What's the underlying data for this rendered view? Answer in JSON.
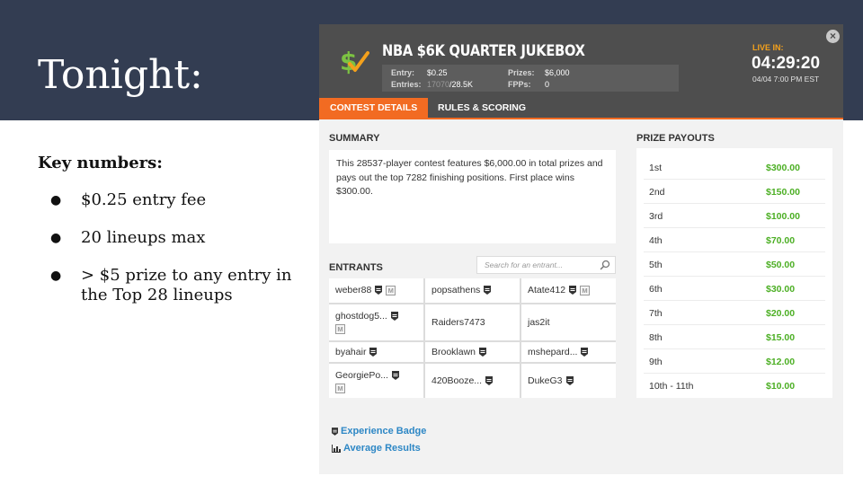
{
  "slide": {
    "title": "Tonight:",
    "key_numbers_title": "Key numbers:",
    "bullets": [
      "$0.25 entry fee",
      "20 lineups max",
      "> $5 prize to any entry in the Top 28 lineups"
    ]
  },
  "contest": {
    "name": "NBA $6K QUARTER JUKEBOX",
    "entry_label": "Entry:",
    "entry_value": "$0.25",
    "entries_label": "Entries:",
    "entries_current": "17070",
    "entries_max": "/28.5K",
    "prizes_label": "Prizes:",
    "prizes_value": "$6,000",
    "fpps_label": "FPPs:",
    "fpps_value": "0",
    "live_label": "LIVE IN:",
    "countdown": "04:29:20",
    "start_time": "04/04 7:00 PM EST",
    "close_symbol": "×"
  },
  "tabs": [
    {
      "label": "CONTEST DETAILS",
      "active": true
    },
    {
      "label": "RULES & SCORING",
      "active": false
    }
  ],
  "summary": {
    "heading": "SUMMARY",
    "text": "This 28537-player contest features $6,000.00 in total prizes and pays out the top 7282 finishing positions. First place wins $300.00."
  },
  "entrants": {
    "heading": "ENTRANTS",
    "search_placeholder": "Search for an entrant...",
    "rows": [
      [
        {
          "name": "weber88",
          "badge": true,
          "m": true
        },
        {
          "name": "popsathens",
          "badge": true,
          "m": false
        },
        {
          "name": "Atate412",
          "badge": true,
          "m": true
        }
      ],
      [
        {
          "name": "ghostdog5...",
          "badge": true,
          "m": true
        },
        {
          "name": "Raiders7473",
          "badge": false,
          "m": false
        },
        {
          "name": "jas2it",
          "badge": false,
          "m": false
        }
      ],
      [
        {
          "name": "byahair",
          "badge": true,
          "m": false
        },
        {
          "name": "Brooklawn",
          "badge": true,
          "m": false
        },
        {
          "name": "mshepard...",
          "badge": true,
          "m": false
        }
      ],
      [
        {
          "name": "GeorgiePo...",
          "badge": true,
          "m": true
        },
        {
          "name": "420Booze...",
          "badge": true,
          "m": false
        },
        {
          "name": "DukeG3",
          "badge": true,
          "m": false
        }
      ]
    ],
    "m_label": "M"
  },
  "legend": {
    "experience_badge": "Experience Badge",
    "average_results": "Average Results"
  },
  "payouts": {
    "heading": "PRIZE PAYOUTS",
    "rows": [
      {
        "place": "1st",
        "amount": "$300.00"
      },
      {
        "place": "2nd",
        "amount": "$150.00"
      },
      {
        "place": "3rd",
        "amount": "$100.00"
      },
      {
        "place": "4th",
        "amount": "$70.00"
      },
      {
        "place": "5th",
        "amount": "$50.00"
      },
      {
        "place": "6th",
        "amount": "$30.00"
      },
      {
        "place": "7th",
        "amount": "$20.00"
      },
      {
        "place": "8th",
        "amount": "$15.00"
      },
      {
        "place": "9th",
        "amount": "$12.00"
      },
      {
        "place": "10th - 11th",
        "amount": "$10.00"
      }
    ]
  },
  "colors": {
    "slide_band": "#333d52",
    "header_bg": "#4e4e4e",
    "accent_orange": "#f26b22",
    "live_orange": "#f4a11c",
    "prize_green": "#4caf24",
    "link_blue": "#2d87c5"
  }
}
